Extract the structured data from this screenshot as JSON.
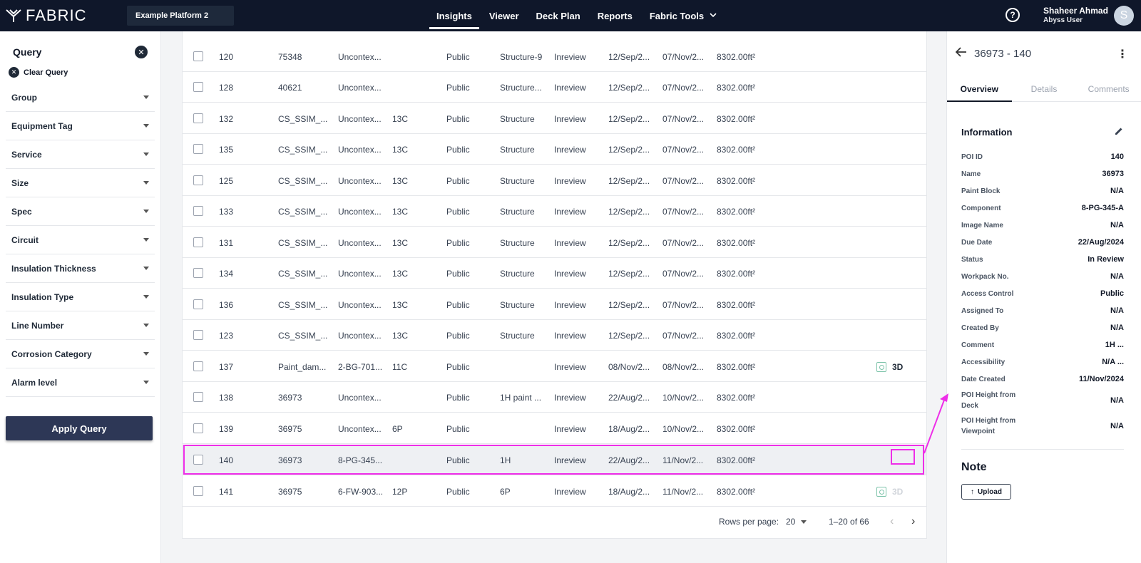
{
  "topbar": {
    "logo": "FABRIC",
    "platform": "Example Platform 2",
    "nav": [
      {
        "label": "Insights"
      },
      {
        "label": "Viewer"
      },
      {
        "label": "Deck Plan"
      },
      {
        "label": "Reports"
      },
      {
        "label": "Fabric Tools"
      }
    ],
    "help_glyph": "?",
    "user_name": "Shaheer Ahmad",
    "user_role": "Abyss User",
    "avatar_letter": "S"
  },
  "query": {
    "title": "Query",
    "clear_label": "Clear Query",
    "filters": [
      "Group",
      "Equipment Tag",
      "Service",
      "Size",
      "Spec",
      "Circuit",
      "Insulation Thickness",
      "Insulation Type",
      "Line Number",
      "Corrosion Category",
      "Alarm level"
    ],
    "apply_label": "Apply Query"
  },
  "table": {
    "rows": [
      {
        "c1": "120",
        "c2": "75348",
        "c3": "Uncontex...",
        "c4": "",
        "c5": "Public",
        "c6": "Structure-9",
        "c7": "Inreview",
        "c8": "12/Sep/2...",
        "c9": "07/Nov/2...",
        "c10": "8302.00ft²",
        "d3": ""
      },
      {
        "c1": "128",
        "c2": "40621",
        "c3": "Uncontex...",
        "c4": "",
        "c5": "Public",
        "c6": "Structure...",
        "c7": "Inreview",
        "c8": "12/Sep/2...",
        "c9": "07/Nov/2...",
        "c10": "8302.00ft²",
        "d3": ""
      },
      {
        "c1": "132",
        "c2": "CS_SSIM_...",
        "c3": "Uncontex...",
        "c4": "13C",
        "c5": "Public",
        "c6": "Structure",
        "c7": "Inreview",
        "c8": "12/Sep/2...",
        "c9": "07/Nov/2...",
        "c10": "8302.00ft²",
        "d3": ""
      },
      {
        "c1": "135",
        "c2": "CS_SSIM_...",
        "c3": "Uncontex...",
        "c4": "13C",
        "c5": "Public",
        "c6": "Structure",
        "c7": "Inreview",
        "c8": "12/Sep/2...",
        "c9": "07/Nov/2...",
        "c10": "8302.00ft²",
        "d3": ""
      },
      {
        "c1": "125",
        "c2": "CS_SSIM_...",
        "c3": "Uncontex...",
        "c4": "13C",
        "c5": "Public",
        "c6": "Structure",
        "c7": "Inreview",
        "c8": "12/Sep/2...",
        "c9": "07/Nov/2...",
        "c10": "8302.00ft²",
        "d3": ""
      },
      {
        "c1": "133",
        "c2": "CS_SSIM_...",
        "c3": "Uncontex...",
        "c4": "13C",
        "c5": "Public",
        "c6": "Structure",
        "c7": "Inreview",
        "c8": "12/Sep/2...",
        "c9": "07/Nov/2...",
        "c10": "8302.00ft²",
        "d3": ""
      },
      {
        "c1": "131",
        "c2": "CS_SSIM_...",
        "c3": "Uncontex...",
        "c4": "13C",
        "c5": "Public",
        "c6": "Structure",
        "c7": "Inreview",
        "c8": "12/Sep/2...",
        "c9": "07/Nov/2...",
        "c10": "8302.00ft²",
        "d3": ""
      },
      {
        "c1": "134",
        "c2": "CS_SSIM_...",
        "c3": "Uncontex...",
        "c4": "13C",
        "c5": "Public",
        "c6": "Structure",
        "c7": "Inreview",
        "c8": "12/Sep/2...",
        "c9": "07/Nov/2...",
        "c10": "8302.00ft²",
        "d3": ""
      },
      {
        "c1": "136",
        "c2": "CS_SSIM_...",
        "c3": "Uncontex...",
        "c4": "13C",
        "c5": "Public",
        "c6": "Structure",
        "c7": "Inreview",
        "c8": "12/Sep/2...",
        "c9": "07/Nov/2...",
        "c10": "8302.00ft²",
        "d3": ""
      },
      {
        "c1": "123",
        "c2": "CS_SSIM_...",
        "c3": "Uncontex...",
        "c4": "13C",
        "c5": "Public",
        "c6": "Structure",
        "c7": "Inreview",
        "c8": "12/Sep/2...",
        "c9": "07/Nov/2...",
        "c10": "8302.00ft²",
        "d3": ""
      },
      {
        "c1": "137",
        "c2": "Paint_dam...",
        "c3": "2-BG-701...",
        "c4": "11C",
        "c5": "Public",
        "c6": "",
        "c7": "Inreview",
        "c8": "08/Nov/2...",
        "c9": "08/Nov/2...",
        "c10": "8302.00ft²",
        "d3": "3D"
      },
      {
        "c1": "138",
        "c2": "36973",
        "c3": "Uncontex...",
        "c4": "",
        "c5": "Public",
        "c6": "1H paint ...",
        "c7": "Inreview",
        "c8": "22/Aug/2...",
        "c9": "10/Nov/2...",
        "c10": "8302.00ft²",
        "d3": ""
      },
      {
        "c1": "139",
        "c2": "36975",
        "c3": "Uncontex...",
        "c4": "6P",
        "c5": "Public",
        "c6": "",
        "c7": "Inreview",
        "c8": "18/Aug/2...",
        "c9": "10/Nov/2...",
        "c10": "8302.00ft²",
        "d3": ""
      },
      {
        "c1": "140",
        "c2": "36973",
        "c3": "8-PG-345...",
        "c4": "",
        "c5": "Public",
        "c6": "1H",
        "c7": "Inreview",
        "c8": "22/Aug/2...",
        "c9": "11/Nov/2...",
        "c10": "8302.00ft²",
        "d3": ""
      },
      {
        "c1": "141",
        "c2": "36975",
        "c3": "6-FW-903...",
        "c4": "12P",
        "c5": "Public",
        "c6": "6P",
        "c7": "Inreview",
        "c8": "18/Aug/2...",
        "c9": "11/Nov/2...",
        "c10": "8302.00ft²",
        "d3": "3D"
      }
    ],
    "pager": {
      "rows_per_page_label": "Rows per page:",
      "rows_per_page_value": "20",
      "range": "1–20 of 66"
    }
  },
  "detail": {
    "title": "36973 - 140",
    "tabs": [
      "Overview",
      "Details",
      "Comments"
    ],
    "info_title": "Information",
    "fields": [
      {
        "k": "POI ID",
        "v": "140"
      },
      {
        "k": "Name",
        "v": "36973"
      },
      {
        "k": "Paint Block",
        "v": "N/A"
      },
      {
        "k": "Component",
        "v": "8-PG-345-A"
      },
      {
        "k": "Image Name",
        "v": "N/A"
      },
      {
        "k": "Due Date",
        "v": "22/Aug/2024"
      },
      {
        "k": "Status",
        "v": "In Review"
      },
      {
        "k": "Workpack No.",
        "v": "N/A"
      },
      {
        "k": "Access Control",
        "v": "Public"
      },
      {
        "k": "Assigned To",
        "v": "N/A"
      },
      {
        "k": "Created By",
        "v": "N/A"
      },
      {
        "k": "Comment",
        "v": "1H ..."
      },
      {
        "k": "Accessibility",
        "v": "N/A ..."
      },
      {
        "k": "Date Created",
        "v": "11/Nov/2024"
      },
      {
        "k": "POI Height from Deck",
        "v": "N/A"
      },
      {
        "k": "POI Height from Viewpoint",
        "v": "N/A"
      }
    ],
    "note_title": "Note",
    "upload_label": "Upload"
  },
  "colors": {
    "topbar": "#0f172a",
    "apply_button": "#2d3756",
    "highlight": "#ee2ee8",
    "cube_icon": "#7cc3a9"
  }
}
